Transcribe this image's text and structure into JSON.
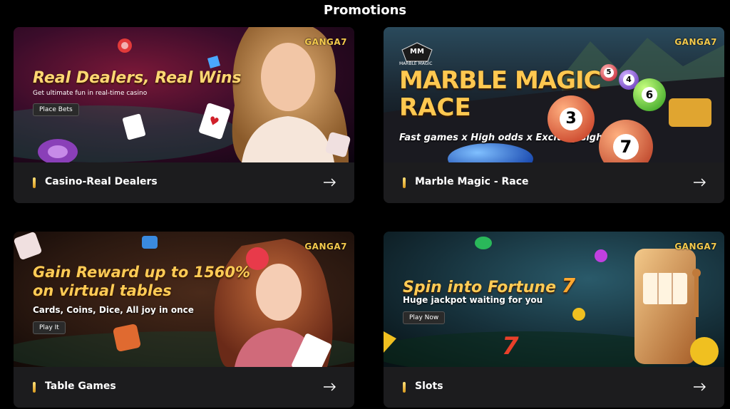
{
  "page": {
    "title": "Promotions"
  },
  "brand": {
    "logo_text": "GANGA7",
    "accent_color": "#f3c94c"
  },
  "cards": [
    {
      "label": "Casino-Real Dealers",
      "headline": "Real Dealers, Real Wins",
      "subtitle": "Get ultimate fun in real-time casino",
      "cta": "Place Bets",
      "arrow_icon": "arrow-right-icon"
    },
    {
      "label": "Marble Magic - Race",
      "badge_monogram": "MM",
      "badge_text": "MARBLE MAGIC",
      "headline_line1": "MARBLE MAGIC",
      "headline_line2": "RACE",
      "tagline": "Fast games x High odds x Exciting sight",
      "balls": [
        "5",
        "4",
        "6",
        "3",
        "7"
      ],
      "arrow_icon": "arrow-right-icon"
    },
    {
      "label": "Table Games",
      "headline_line1": "Gain Reward up to 1560%",
      "headline_line2": "on virtual tables",
      "subtitle": "Cards, Coins, Dice, All joy in once",
      "cta": "Play It",
      "arrow_icon": "arrow-right-icon"
    },
    {
      "label": "Slots",
      "headline": "Spin into Fortune",
      "headline_number": "7",
      "subtitle": "Huge jackpot waiting for you",
      "cta": "Play Now",
      "arrow_icon": "arrow-right-icon"
    }
  ]
}
